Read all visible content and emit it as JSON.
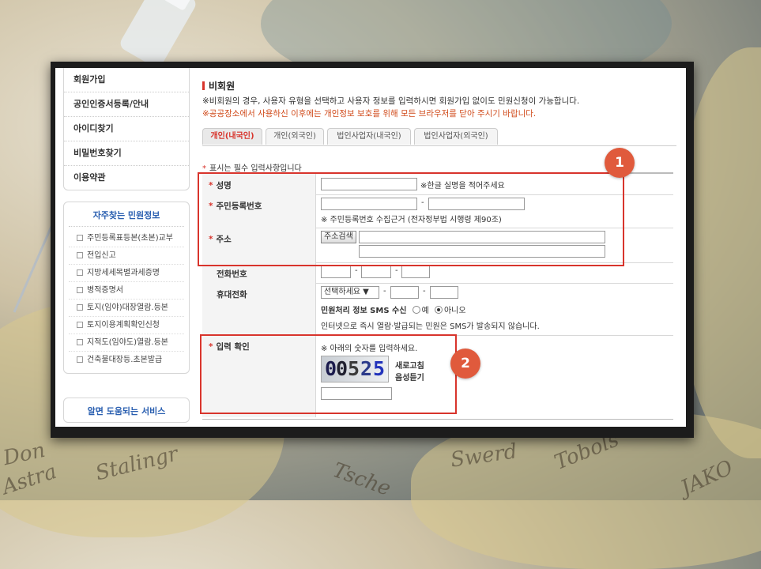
{
  "sidebar": {
    "menu": [
      "회원가입",
      "공인인증서등록/안내",
      "아이디찾기",
      "비밀번호찾기",
      "이용약관"
    ],
    "faq_title": "자주찾는 민원정보",
    "faq_items": [
      "주민등록표등본(초본)교부",
      "전입신고",
      "지방세세목별과세증명",
      "병적증명서",
      "토지(임야)대장열람.등본",
      "토지이용계획확인신청",
      "지적도(임야도)열람.등본",
      "건축물대장등.초본발급"
    ],
    "service_title": "알면 도움되는 서비스"
  },
  "main": {
    "heading": "비회원",
    "desc1": "※비회원의 경우, 사용자 유형을 선택하고 사용자 정보를 입력하시면 회원가입 없이도 민원신청이 가능합니다.",
    "desc2": "※공공장소에서 사용하신 이후에는 개인정보 보호를 위해 모든 브라우저를 닫아 주시기 바랍니다.",
    "tabs": [
      "개인(내국인)",
      "개인(외국인)",
      "법인사업자(내국인)",
      "법인사업자(외국인)"
    ],
    "active_tab": "개인(내국인)",
    "required_note": "표시는 필수 입력사항입니다",
    "required_star": "*"
  },
  "form": {
    "name": {
      "label": "성명",
      "hint": "※한글 실명을 적어주세요"
    },
    "rrn": {
      "label": "주민등록번호",
      "dash": "-",
      "note": "※ 주민등록번호 수집근거 (전자정부법 시행령 제90조)"
    },
    "address": {
      "label": "주소",
      "search_button": "주소검색"
    },
    "phone": {
      "label": "전화번호",
      "dash": "-"
    },
    "mobile": {
      "label": "휴대전화",
      "select_value": "선택하세요 ▼",
      "dash": "-",
      "sms_label": "민원처리 정보 SMS 수신",
      "yes": "예",
      "no": "아니오",
      "selected": "아니오",
      "sms_note": "인터넷으로 즉시 열람·발급되는 민원은 SMS가 발송되지 않습니다."
    },
    "captcha": {
      "label": "입력 확인",
      "instruction": "※ 아래의 숫자를 입력하세요.",
      "digits": [
        "0",
        "0",
        "5",
        "2",
        "5"
      ],
      "refresh": "새로고침",
      "audio": "음성듣기"
    }
  },
  "annotations": {
    "badge1": "1",
    "badge2": "2",
    "color": "#d8342c"
  },
  "background": {
    "map_words": [
      "Don",
      "Astra",
      "Stalingr",
      "Tsche",
      "Swerd",
      "Tobols",
      "JAKO"
    ]
  }
}
